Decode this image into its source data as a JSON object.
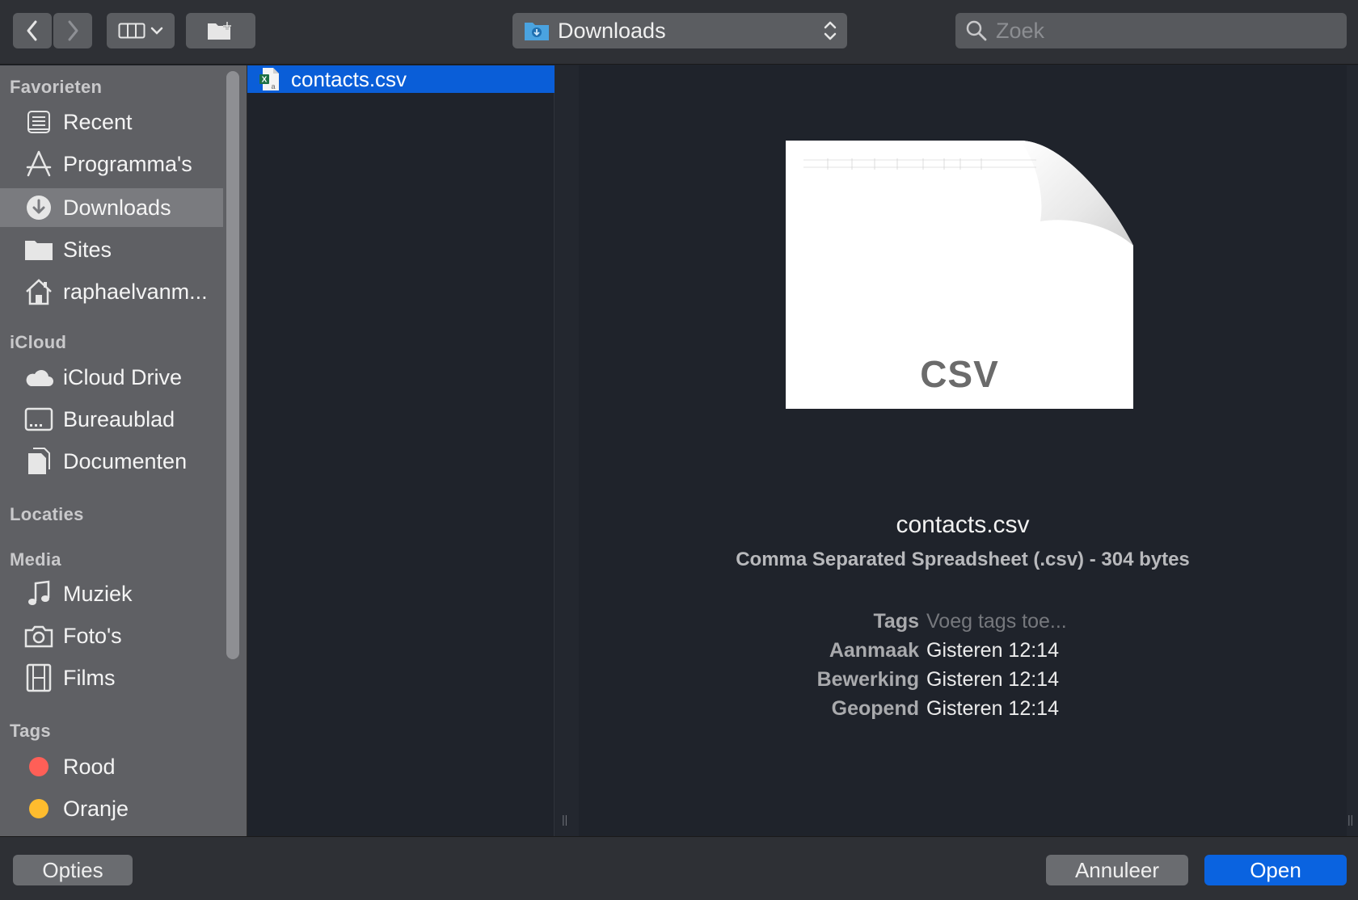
{
  "toolbar": {
    "back_icon": "chevron-left-icon",
    "forward_icon": "chevron-right-icon",
    "view_icon": "column-view-icon",
    "new_folder_icon": "new-folder-icon",
    "location": "Downloads",
    "search_placeholder": "Zoek"
  },
  "sidebar": {
    "sections": [
      {
        "heading": "Favorieten",
        "items": [
          {
            "label": "Recent",
            "icon": "recent-icon"
          },
          {
            "label": "Programma's",
            "icon": "applications-icon"
          },
          {
            "label": "Downloads",
            "icon": "downloads-icon",
            "selected": true
          },
          {
            "label": "Sites",
            "icon": "folder-icon"
          },
          {
            "label": "raphaelvanm...",
            "icon": "home-icon"
          }
        ]
      },
      {
        "heading": "iCloud",
        "items": [
          {
            "label": "iCloud Drive",
            "icon": "cloud-icon"
          },
          {
            "label": "Bureaublad",
            "icon": "desktop-icon"
          },
          {
            "label": "Documenten",
            "icon": "documents-icon"
          }
        ]
      },
      {
        "heading": "Locaties",
        "items": []
      },
      {
        "heading": "Media",
        "items": [
          {
            "label": "Muziek",
            "icon": "music-icon"
          },
          {
            "label": "Foto's",
            "icon": "camera-icon"
          },
          {
            "label": "Films",
            "icon": "film-icon"
          }
        ]
      },
      {
        "heading": "Tags",
        "items": [
          {
            "label": "Rood",
            "icon": "red-tag-icon",
            "color": "#ff5f57"
          },
          {
            "label": "Oranje",
            "icon": "orange-tag-icon",
            "color": "#febc2e"
          }
        ]
      }
    ]
  },
  "files": [
    {
      "name": "contacts.csv",
      "icon": "excel-csv-icon",
      "selected": true
    }
  ],
  "preview": {
    "doc_label": "CSV",
    "name": "contacts.csv",
    "kind": "Comma Separated Spreadsheet (.csv) - 304 bytes",
    "meta": [
      {
        "key": "Tags",
        "value": "Voeg tags toe...",
        "placeholder": true
      },
      {
        "key": "Aanmaak",
        "value": "Gisteren 12:14"
      },
      {
        "key": "Bewerking",
        "value": "Gisteren 12:14"
      },
      {
        "key": "Geopend",
        "value": "Gisteren 12:14"
      }
    ]
  },
  "buttons": {
    "options": "Opties",
    "cancel": "Annuleer",
    "open": "Open"
  },
  "colors": {
    "accent": "#0a63e0",
    "selection": "#0a5ed8"
  }
}
